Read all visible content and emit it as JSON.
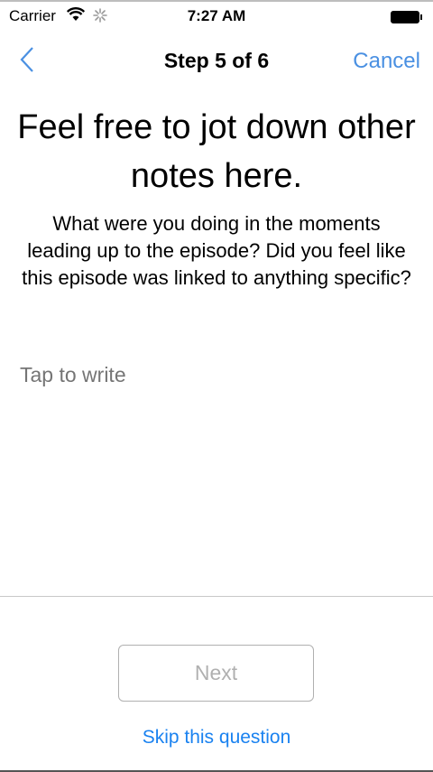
{
  "status_bar": {
    "carrier": "Carrier",
    "time": "7:27 AM",
    "icons": [
      "wifi-icon",
      "activity-spinner-icon",
      "battery-icon"
    ]
  },
  "nav": {
    "title": "Step 5 of 6",
    "cancel_label": "Cancel",
    "back_icon": "chevron-left-icon",
    "accent": "#4a90e2"
  },
  "main": {
    "heading": "Feel free to jot down other notes here.",
    "subtitle": "What were you doing in the moments leading up to the episode? Did you feel like this episode was linked to anything specific?",
    "notes_placeholder": "Tap to write",
    "notes_value": ""
  },
  "footer": {
    "next_label": "Next",
    "skip_label": "Skip this question",
    "link_color": "#1a82f0"
  }
}
